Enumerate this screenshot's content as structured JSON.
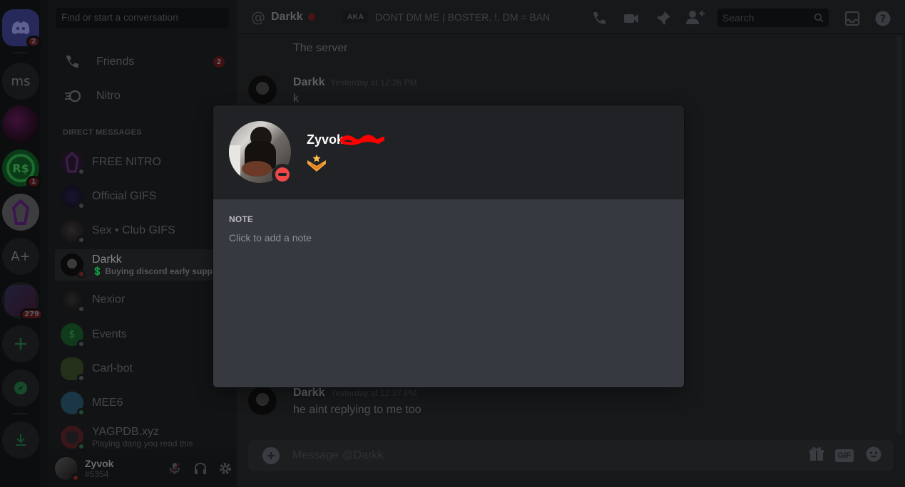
{
  "guilds": {
    "home_badge": "2",
    "ms_label": "ms",
    "rs_badge": "1",
    "aplus_label": "A+",
    "multi_badge": "279"
  },
  "dm_list": {
    "search_placeholder": "Find or start a conversation",
    "friends_label": "Friends",
    "friends_badge": "2",
    "nitro_label": "Nitro",
    "section_header": "DIRECT MESSAGES",
    "items": [
      {
        "name": "FREE NITRO",
        "sub": ""
      },
      {
        "name": "Official GIFS",
        "sub": ""
      },
      {
        "name": "Sex • Club GIFS",
        "sub": ""
      },
      {
        "name": "Darkk",
        "sub": "Buying discord early supp..."
      },
      {
        "name": "Nexior",
        "sub": ""
      },
      {
        "name": "Events",
        "sub": ""
      },
      {
        "name": "Carl-bot",
        "sub": ""
      },
      {
        "name": "MEE6",
        "sub": ""
      },
      {
        "name": "YAGPDB.xyz",
        "sub": "Playing dang you read this"
      }
    ]
  },
  "user_panel": {
    "username": "Zyvok",
    "tag": "#5354"
  },
  "topbar": {
    "channel_name": "Darkk",
    "aka_label": "AKA",
    "aka_text": "DONT DM ME | BOSTER, !, DM = BAN",
    "search_placeholder": "Search"
  },
  "messages": {
    "first_line": "The server",
    "group1_author": "Darkk",
    "group1_time": "Yesterday at 12:26 PM",
    "group1_text": "k",
    "group2_author": "Darkk",
    "group2_time": "Yesterday at 12:37 PM",
    "group2_text": "he aint replying to me too"
  },
  "composer": {
    "placeholder": "Message @Darkk",
    "gif_label": "GIF"
  },
  "modal": {
    "username": "Zyvok",
    "note_label": "NOTE",
    "note_placeholder": "Click to add a note"
  },
  "colors": {
    "modal_body": "#36393f",
    "modal_header": "#202225",
    "dnd": "#f04747",
    "redaction": "#ff0000"
  }
}
